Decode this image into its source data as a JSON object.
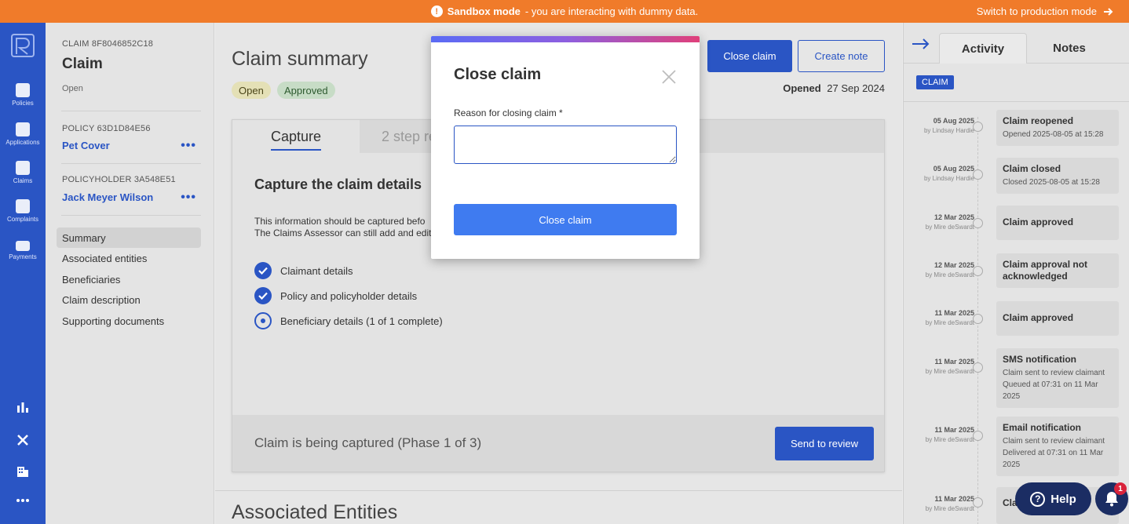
{
  "banner": {
    "mode_bold": "Sandbox mode",
    "mode_rest": "- you are interacting with dummy data.",
    "switch_label": "Switch to production mode",
    "color": "#f07b2a"
  },
  "nav": {
    "items": [
      {
        "label": "Policies",
        "icon": "policies-icon"
      },
      {
        "label": "Applications",
        "icon": "applications-icon"
      },
      {
        "label": "Claims",
        "icon": "claims-icon"
      },
      {
        "label": "Complaints",
        "icon": "complaints-icon"
      },
      {
        "label": "Payments",
        "icon": "payments-icon"
      }
    ],
    "bottom_icons": [
      "bar-chart-icon",
      "tools-icon",
      "building-icon",
      "more-icon"
    ],
    "color": "#2a55c4"
  },
  "claim_panel": {
    "claim_id": "CLAIM 8F8046852C18",
    "title": "Claim",
    "status": "Open",
    "policy_id": "POLICY 63D1D84E56",
    "policy_name": "Pet Cover",
    "policyholder_id": "POLICYHOLDER 3A548E51",
    "policyholder_name": "Jack Meyer Wilson",
    "menu": [
      "Summary",
      "Associated entities",
      "Beneficiaries",
      "Claim description",
      "Supporting documents"
    ]
  },
  "main": {
    "title": "Claim summary",
    "badges": {
      "open": "Open",
      "approved": "Approved"
    },
    "close_claim_label": "Close claim",
    "create_note_label": "Create note",
    "opened_label": "Opened",
    "opened_date": "27 Sep 2024",
    "tabs": {
      "capture": "Capture",
      "step2": "2 step re"
    },
    "capture_heading": "Capture the claim details",
    "capture_text_1": "This information should be captured befo",
    "capture_text_2": "The Claims Assessor can still add and edit",
    "checklist": [
      {
        "label": "Claimant details",
        "state": "complete"
      },
      {
        "label": "Policy and policyholder details",
        "state": "complete"
      },
      {
        "label": "Beneficiary details (1 of 1 complete)",
        "state": "in-progress"
      }
    ],
    "footer_status": "Claim is being captured (Phase 1 of 3)",
    "send_review_label": "Send to review",
    "associated_title": "Associated Entities"
  },
  "activity": {
    "tabs": {
      "activity": "Activity",
      "notes": "Notes"
    },
    "chip": "CLAIM",
    "items": [
      {
        "date": "05 Aug 2025",
        "by": "by Lindsay Hardie",
        "title": "Claim reopened",
        "detail": [
          "Opened 2025-08-05 at 15:28"
        ]
      },
      {
        "date": "05 Aug 2025",
        "by": "by Lindsay Hardie",
        "title": "Claim closed",
        "detail": [
          "Closed 2025-08-05 at 15:28"
        ]
      },
      {
        "date": "12 Mar 2025",
        "by": "by Mire deSwardt",
        "title": "Claim approved",
        "detail": []
      },
      {
        "date": "12 Mar 2025",
        "by": "by Mire deSwardt",
        "title": "Claim approval not acknowledged",
        "detail": []
      },
      {
        "date": "11 Mar 2025",
        "by": "by Mire deSwardt",
        "title": "Claim approved",
        "detail": []
      },
      {
        "date": "11 Mar 2025",
        "by": "by Mire deSwardt",
        "title": "SMS notification",
        "detail": [
          "Claim sent to review claimant",
          "Queued at 07:31 on 11 Mar 2025"
        ]
      },
      {
        "date": "11 Mar 2025",
        "by": "by Mire deSwardt",
        "title": "Email notification",
        "detail": [
          "Claim sent to review claimant",
          "Delivered at 07:31 on 11 Mar 2025"
        ]
      },
      {
        "date": "11 Mar 2025",
        "by": "by Mire deSwardt",
        "title": "Cla",
        "detail": []
      }
    ]
  },
  "help": {
    "label": "Help",
    "badge_count": "1"
  },
  "modal": {
    "title": "Close claim",
    "field_label": "Reason for closing claim *",
    "field_value": "",
    "submit_label": "Close claim"
  }
}
